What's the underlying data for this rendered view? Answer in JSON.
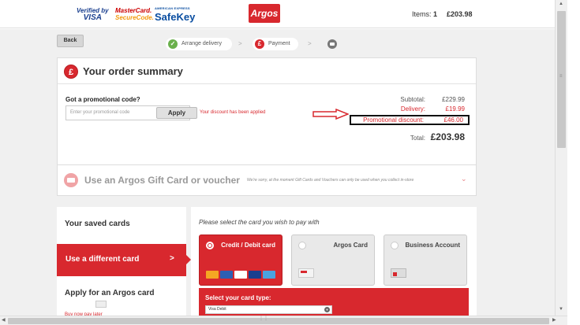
{
  "header": {
    "vbv_line1": "Verified by",
    "vbv_line2": "VISA",
    "mc_line1": "MasterCard.",
    "mc_line2": "SecureCode.",
    "amex_small": "AMERICAN EXPRESS",
    "safekey": "SafeKey",
    "logo": "Argos",
    "items_label": "Items:",
    "items_count": "1",
    "basket_total": "£203.98"
  },
  "nav": {
    "back": "Back",
    "steps": [
      {
        "label": "Arrange delivery",
        "icon": "check-icon"
      },
      {
        "label": "Payment",
        "icon": "pound-icon"
      }
    ],
    "arrow": ">"
  },
  "summary": {
    "title": "Your order summary",
    "promo_label": "Got a promotional code?",
    "promo_placeholder": "Enter your promotional code",
    "apply": "Apply",
    "discount_msg": "Your discount has been applied",
    "subtotal_label": "Subtotal:",
    "subtotal": "£229.99",
    "delivery_label": "Delivery:",
    "delivery": "£19.99",
    "promo_disc_label": "Promotional discount:",
    "promo_disc": "£46.00",
    "total_label": "Total:",
    "total": "£203.98"
  },
  "gift": {
    "title": "Use an Argos Gift Card or voucher",
    "note": "We're sorry, at the moment Gift Cards and Vouchers can only be used when you collect in-store"
  },
  "saved": {
    "title": "Your saved cards",
    "different": "Use a different card",
    "chevron": ">",
    "apply_title": "Apply for an Argos card",
    "buy_now": "Buy now pay later"
  },
  "cards": {
    "prompt": "Please select the card you wish to pay with",
    "types": [
      {
        "label": "Credit / Debit card",
        "selected": true
      },
      {
        "label": "Argos Card",
        "selected": false
      },
      {
        "label": "Business Account",
        "selected": false
      }
    ],
    "type_label": "Select your card type:",
    "type_value": "Visa Debit"
  },
  "colors": {
    "brand_red": "#d8282e",
    "success_green": "#6ab04c"
  }
}
